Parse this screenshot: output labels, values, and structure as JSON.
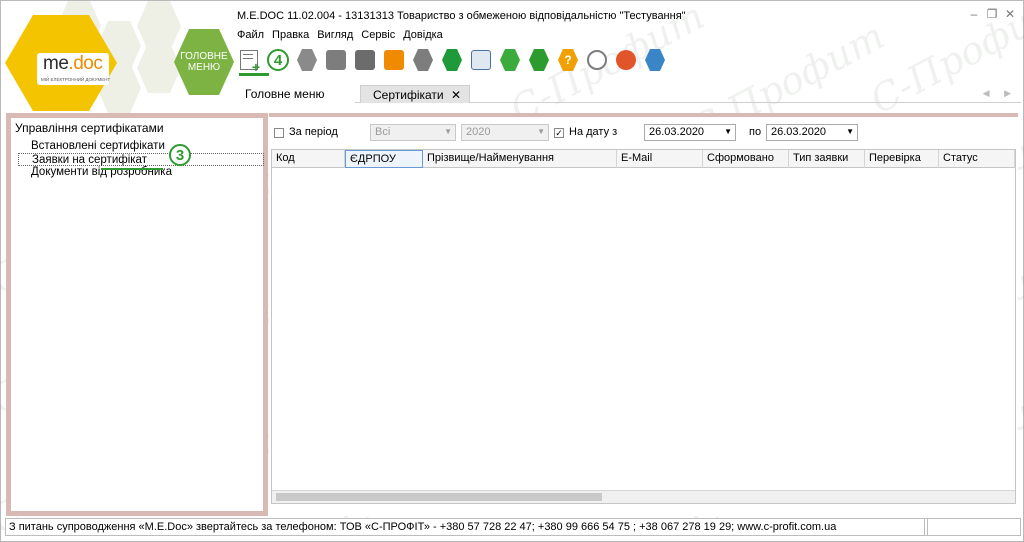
{
  "app": {
    "title": "M.E.DOC 11.02.004 - 13131313 Товариство з обмеженою відповідальністю \"Тестування\"",
    "logo_text_me": "me",
    "logo_text_doc": "doc",
    "logo_subtitle": "МІЙ ЕЛЕКТРОННИЙ ДОКУМЕНТ",
    "main_menu_label_1": "ГОЛОВНЕ",
    "main_menu_label_2": "МЕНЮ",
    "minimize": "‒",
    "maximize": "❐",
    "close": "✕"
  },
  "menu": [
    "Файл",
    "Правка",
    "Вигляд",
    "Сервіс",
    "Довідка"
  ],
  "toolbar": {
    "badge_4": "4",
    "icons": [
      {
        "name": "new-request-icon",
        "color": "#2e9b2e"
      },
      {
        "name": "update-icon",
        "color": "#8a8a8a"
      },
      {
        "name": "send-icon",
        "color": "#7d7d7d"
      },
      {
        "name": "receive-icon",
        "color": "#9a9a9a"
      },
      {
        "name": "print-icon",
        "color": "#6c6c6c"
      },
      {
        "name": "export-icon",
        "color": "#f08a00"
      },
      {
        "name": "search-icon",
        "color": "#7d7d7d"
      },
      {
        "name": "download-icon",
        "color": "#1f9a3a"
      },
      {
        "name": "settings-icon",
        "color": "#4a6fa5"
      },
      {
        "name": "refresh-icon",
        "color": "#3bab3b"
      },
      {
        "name": "info-icon",
        "color": "#2e9b2e"
      },
      {
        "name": "help-icon",
        "color": "#f0a000"
      },
      {
        "name": "chat-icon",
        "color": "#7d7d7d"
      },
      {
        "name": "message-icon",
        "color": "#e2542a"
      },
      {
        "name": "user-icon",
        "color": "#3a85c5"
      }
    ]
  },
  "tabs": {
    "home": "Головне меню",
    "certificates": "Сертифікати",
    "close": "✕",
    "arrows": "◀ ▶"
  },
  "left_panel": {
    "title": "Управління сертифікатами",
    "items": [
      "Встановлені сертифікати",
      "Заявки на сертифікат",
      "Документи від розробника"
    ],
    "badge_3": "3"
  },
  "filters": {
    "period_label": "За період",
    "period_checked": false,
    "period_value": "Всі",
    "year_value": "2020",
    "date_label": "На дату з",
    "date_checked": true,
    "date_from": "26.03.2020",
    "to_label": "по",
    "date_to": "26.03.2020"
  },
  "grid": {
    "columns": [
      "Код",
      "ЄДРПОУ",
      "Прізвище/Найменування",
      "E-Mail",
      "Сформовано",
      "Тип заявки",
      "Перевірка",
      "Статус"
    ],
    "rows": []
  },
  "statusbar": {
    "text": "З питань супроводження «M.E.Doc» звертайтесь за телефоном: ТОВ «С-ПРОФІТ» - +380 57 728 22 47; +380 99 666 54 75 ; +38 067 278 19 29; www.c-profit.com.ua"
  },
  "watermark": "С-Профит"
}
